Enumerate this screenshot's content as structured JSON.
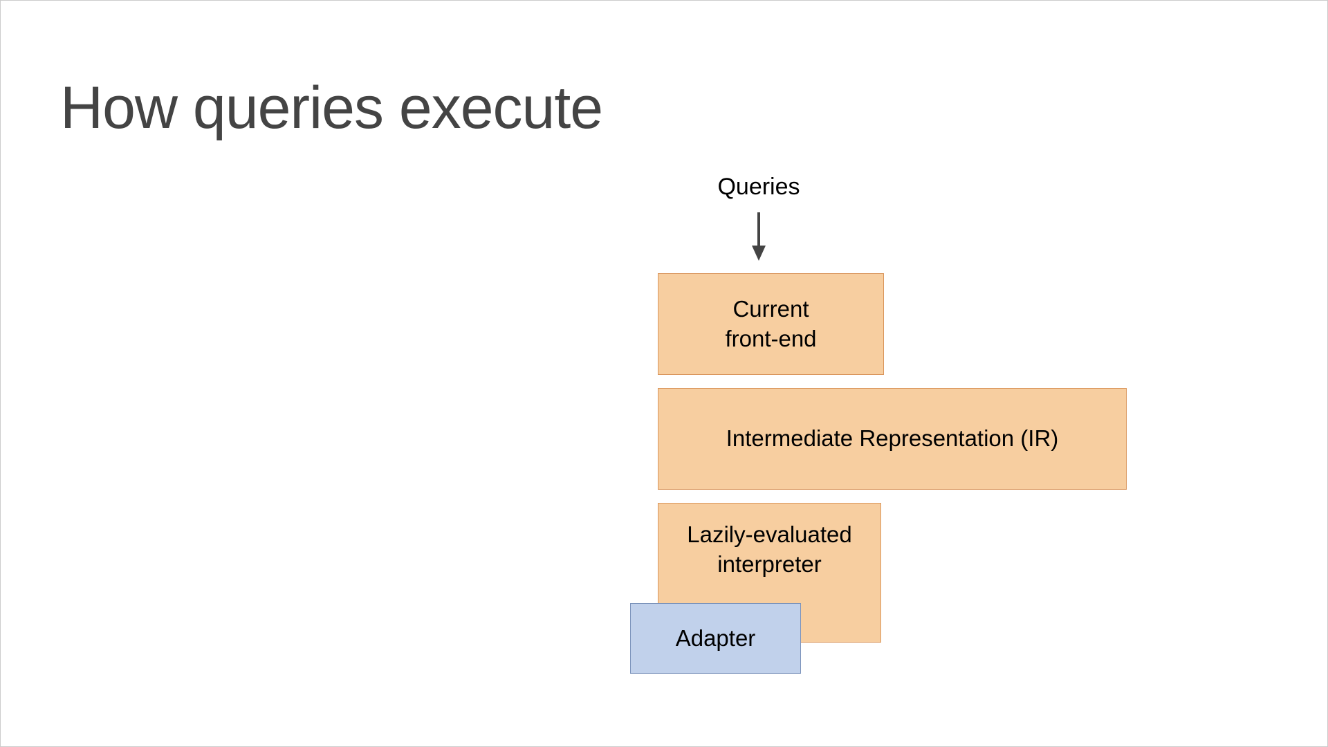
{
  "title": "How queries execute",
  "diagram": {
    "input_label": "Queries",
    "boxes": {
      "frontend": "Current\nfront-end",
      "ir": "Intermediate Representation (IR)",
      "interpreter": "Lazily-evaluated\ninterpreter",
      "adapter": "Adapter"
    }
  },
  "colors": {
    "orange_fill": "#f7ceA0",
    "orange_border": "#d9955b",
    "blue_fill": "#c1d1eb",
    "blue_border": "#7b93bb",
    "title_color": "#444444"
  }
}
